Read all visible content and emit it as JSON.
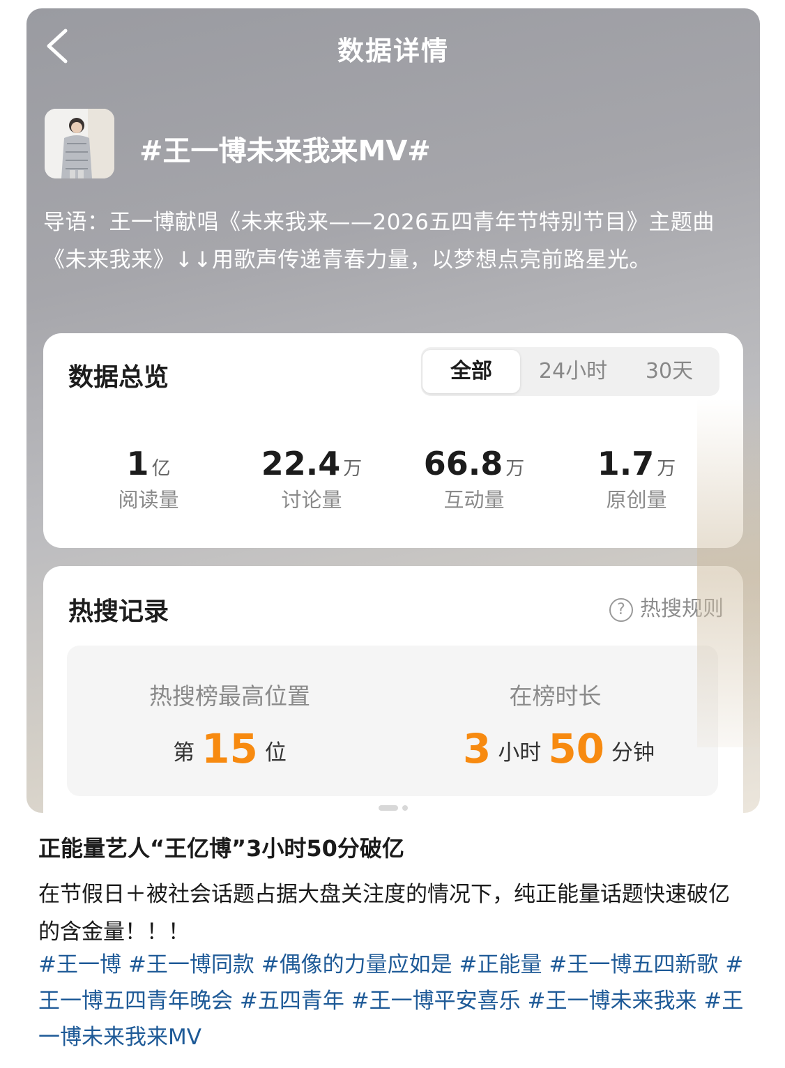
{
  "header": {
    "title": "数据详情",
    "back_icon": "chevron-left-icon"
  },
  "topic": {
    "title": "#王一博未来我来MV#",
    "intro": "导语：王一博献唱《未来我来——2026五四青年节特别节目》主题曲《未来我来》↓↓用歌声传递青春力量，以梦想点亮前路星光。"
  },
  "overview": {
    "heading": "数据总览",
    "tabs": [
      "全部",
      "24小时",
      "30天"
    ],
    "active_tab": "全部",
    "stats": [
      {
        "value": "1",
        "unit": "亿",
        "label": "阅读量"
      },
      {
        "value": "22.4",
        "unit": "万",
        "label": "讨论量"
      },
      {
        "value": "66.8",
        "unit": "万",
        "label": "互动量"
      },
      {
        "value": "1.7",
        "unit": "万",
        "label": "原创量"
      }
    ]
  },
  "hot_search": {
    "heading": "热搜记录",
    "rules_label": "热搜规则",
    "peak": {
      "label": "热搜榜最高位置",
      "prefix": "第",
      "rank": "15",
      "suffix": "位"
    },
    "duration": {
      "label": "在榜时长",
      "hours": "3",
      "hours_unit": "小时",
      "minutes": "50",
      "minutes_unit": "分钟"
    }
  },
  "post": {
    "title": "正能量艺人“王亿博”3小时50分破亿",
    "body": "在节假日＋被社会话题占据大盘关注度的情况下，纯正能量话题快速破亿的含金量！！！",
    "tags": [
      "#王一博",
      "#王一博同款",
      "#偶像的力量应如是",
      "#正能量",
      "#王一博五四新歌",
      "#王一博五四青年晚会",
      "#五四青年",
      "#王一博平安喜乐",
      "#王一博未来我来",
      "#王一博未来我来MV"
    ]
  },
  "colors": {
    "accent_orange": "#f78a10",
    "tag_blue": "#1e5a97"
  }
}
